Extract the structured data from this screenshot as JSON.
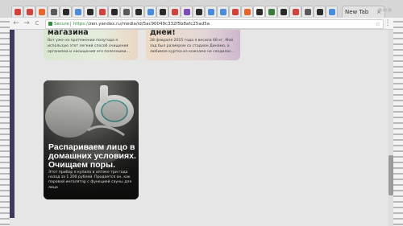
{
  "browser": {
    "tabs_count_visible": 27,
    "favicon_colors": [
      "#d0423b",
      "#d0423b",
      "#e8642c",
      "#5a5a5a",
      "#2b2b2b",
      "#4a8cdb",
      "#2b2b2b",
      "#d0423b",
      "#2b2b2b",
      "#5a5a5a",
      "#2b2b2b",
      "#4a8cdb",
      "#2b2b2b",
      "#d0423b",
      "#7c4bb5",
      "#2b2b2b",
      "#4a8cdb",
      "#4a8cdb",
      "#d0423b",
      "#e8642c",
      "#2b2b2b",
      "#3b7a3b",
      "#2b2b2b",
      "#d0423b",
      "#5a5a5a",
      "#2b2b2b",
      "#4a8cdb"
    ],
    "new_tab_label": "New Tab",
    "toolbar": {
      "back": "←",
      "forward": "→",
      "reload": "C",
      "secure_label": "Secure",
      "url_scheme": "https://",
      "url_rest": "zen.yandex.ru/media/id/5ac90049c332f5b8afc25ad5a",
      "star": "☆",
      "menu": "⋮"
    }
  },
  "feed": {
    "card_a": {
      "title": "магазина",
      "text": "Вот уже на протяжении полугода я использую этот легкий способ очищения организма и насыщения его полезными..."
    },
    "card_b": {
      "title": "дней!",
      "text": "28 февраля 2015 года я весила 68 кг. Мой зад был размером со стадион Динамо, а любимая куртка из кожзама не сходилас..."
    },
    "card_main": {
      "title": "Распариваем лицо в домашних условиях. Очищаем поры.",
      "text": "Этот прибор я купила в аптеке три года назад за 1 200 рублей. Продается он, как паровой ингалятор с функцией сауны для лица"
    }
  },
  "colors": {
    "accent_bar": "#3e3a5c",
    "secure_green": "#2e8b3a"
  }
}
